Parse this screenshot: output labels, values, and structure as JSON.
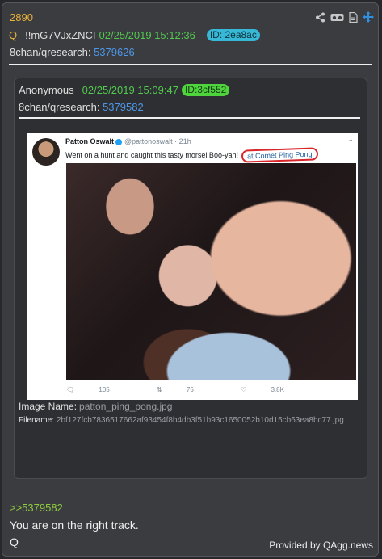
{
  "post": {
    "number": "2890",
    "q_marker": "Q",
    "tripcode": "!!mG7VJxZNCI",
    "date": "02/25/2019 15:12:36",
    "id_badge": "ID: 2ea8ac",
    "board_label": "8chan/qresearch:",
    "board_link": "5379626",
    "icons": [
      "share-icon",
      "vr-goggles-icon",
      "document-icon",
      "move-arrows-icon"
    ],
    "colors": {
      "number": "#e8b13a",
      "date": "#53c94f",
      "link": "#4d96e6",
      "id_badge": "#37b8d6"
    }
  },
  "quoted": {
    "author": "Anonymous",
    "date": "02/25/2019 15:09:47",
    "id_badge": "ID:3cf552",
    "board_label": "8chan/qresearch:",
    "board_link": "5379582",
    "image": {
      "tweet_name": "Patton Oswalt",
      "tweet_handle": "@pattonoswalt · 21h",
      "tweet_text": "Went on a hunt and caught this tasty morsel  Boo-yah!",
      "tweet_highlight": "at Comet Ping Pong",
      "replies": "105",
      "retweets": "75",
      "likes": "3.8K"
    },
    "image_name_label": "Image Name:",
    "image_name": "patton_ping_pong.jpg",
    "filename_label": "Filename:",
    "filename": "2bf127fcb7836517662af93454f8b4db3f51b93c1650052b10d15cb63ea8bc77.jpg"
  },
  "reply_ref": ">>5379582",
  "message": "You are on the right track.",
  "signature": "Q",
  "footer": "Provided by QAgg.news"
}
